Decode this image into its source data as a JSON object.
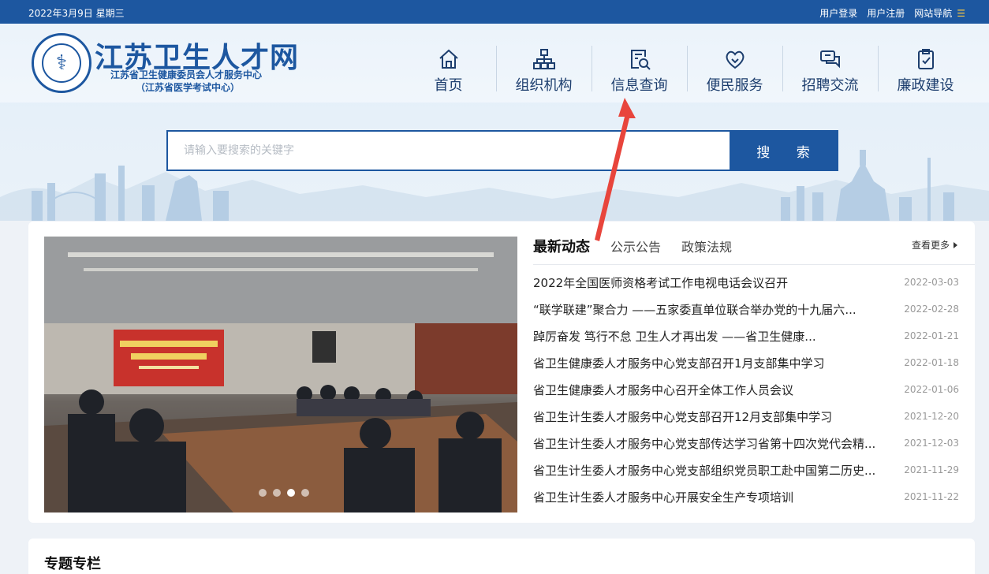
{
  "topbar": {
    "date": "2022年3月9日 星期三",
    "login": "用户登录",
    "register": "用户注册",
    "site_nav": "网站导航"
  },
  "logo": {
    "title": "江苏卫生人才网",
    "subtitle": "江苏省卫生健康委员会人才服务中心",
    "subtitle2": "（江苏省医学考试中心）"
  },
  "nav": {
    "items": [
      {
        "label": "首页",
        "icon": "home-icon"
      },
      {
        "label": "组织机构",
        "icon": "org-chart-icon"
      },
      {
        "label": "信息查询",
        "icon": "search-document-icon"
      },
      {
        "label": "便民服务",
        "icon": "heart-hands-icon"
      },
      {
        "label": "招聘交流",
        "icon": "chat-icon"
      },
      {
        "label": "廉政建设",
        "icon": "clipboard-icon"
      }
    ]
  },
  "search": {
    "placeholder": "请输入要搜索的关键字",
    "button": "搜 索"
  },
  "carousel": {
    "slide_count": 4,
    "active_index": 2
  },
  "news": {
    "tabs": [
      {
        "label": "最新动态",
        "active": true
      },
      {
        "label": "公示公告",
        "active": false
      },
      {
        "label": "政策法规",
        "active": false
      }
    ],
    "more": "查看更多",
    "items": [
      {
        "title": "2022年全国医师资格考试工作电视电话会议召开",
        "date": "2022-03-03"
      },
      {
        "title": "“联学联建”聚合力 ——五家委直单位联合举办党的十九届六...",
        "date": "2022-02-28"
      },
      {
        "title": "踔厉奋发 笃行不怠 卫生人才再出发 ——省卫生健康...",
        "date": "2022-01-21"
      },
      {
        "title": "省卫生健康委人才服务中心党支部召开1月支部集中学习",
        "date": "2022-01-18"
      },
      {
        "title": "省卫生健康委人才服务中心召开全体工作人员会议",
        "date": "2022-01-06"
      },
      {
        "title": "省卫生计生委人才服务中心党支部召开12月支部集中学习",
        "date": "2021-12-20"
      },
      {
        "title": "省卫生计生委人才服务中心党支部传达学习省第十四次党代会精...",
        "date": "2021-12-03"
      },
      {
        "title": "省卫生计生委人才服务中心党支部组织党员职工赴中国第二历史...",
        "date": "2021-11-29"
      },
      {
        "title": "省卫生计生委人才服务中心开展安全生产专项培训",
        "date": "2021-11-22"
      }
    ]
  },
  "special": {
    "heading": "专题专栏"
  },
  "colors": {
    "primary": "#1d57a0",
    "annotation": "#e8453c"
  }
}
